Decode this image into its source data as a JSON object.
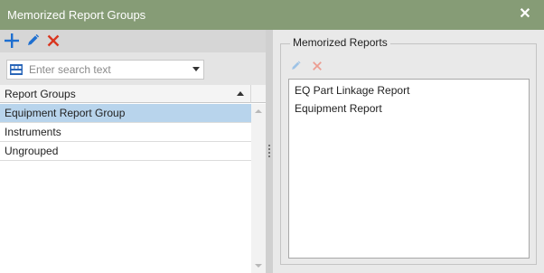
{
  "window": {
    "title": "Memorized Report Groups",
    "close_icon": "close-icon",
    "titlebar_color": "#869c76"
  },
  "left_toolbar": {
    "buttons": [
      {
        "name": "add-icon",
        "color": "#1e6fd0"
      },
      {
        "name": "edit-icon",
        "color": "#1e6fd0"
      },
      {
        "name": "delete-icon",
        "color": "#d9361f"
      }
    ]
  },
  "search": {
    "placeholder": "Enter search text",
    "value": "",
    "icon": "abc-icon"
  },
  "grid": {
    "column_header": "Report Groups",
    "sort": "ascending",
    "rows": [
      {
        "label": "Equipment Report Group",
        "selected": true
      },
      {
        "label": "Instruments",
        "selected": false
      },
      {
        "label": "Ungrouped",
        "selected": false
      }
    ],
    "selected_color": "#b8d4ec"
  },
  "right": {
    "group_title": "Memorized Reports",
    "toolbar": [
      {
        "name": "edit-icon",
        "enabled": false
      },
      {
        "name": "delete-icon",
        "enabled": false
      }
    ],
    "reports": [
      "EQ Part Linkage Report",
      "Equipment Report"
    ]
  }
}
